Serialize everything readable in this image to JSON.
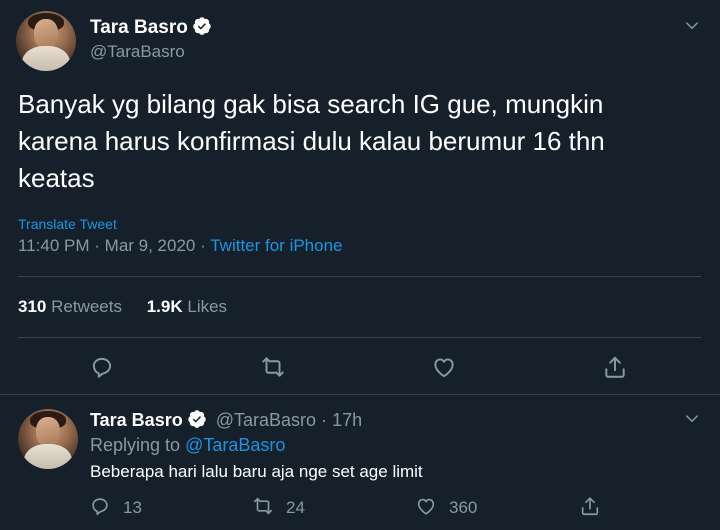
{
  "tweet": {
    "display_name": "Tara Basro",
    "handle": "@TaraBasro",
    "text": "Banyak yg bilang gak bisa search IG gue, mungkin karena harus konfirmasi dulu kalau berumur 16 thn keatas",
    "translate_label": "Translate Tweet",
    "time": "11:40 PM",
    "date": "Mar 9, 2020",
    "source": "Twitter for iPhone",
    "retweets_count": "310",
    "retweets_label": "Retweets",
    "likes_count": "1.9K",
    "likes_label": "Likes"
  },
  "reply": {
    "display_name": "Tara Basro",
    "handle": "@TaraBasro",
    "age": "17h",
    "replying_to_label": "Replying to",
    "replying_to_handle": "@TaraBasro",
    "text": "Beberapa hari lalu baru aja nge set age limit",
    "reply_count": "13",
    "retweet_count": "24",
    "like_count": "360"
  },
  "separators": {
    "dot": "·"
  },
  "colors": {
    "background": "#15202b",
    "accent": "#1b95e0",
    "muted": "#8899a6",
    "divider": "#38444d"
  }
}
